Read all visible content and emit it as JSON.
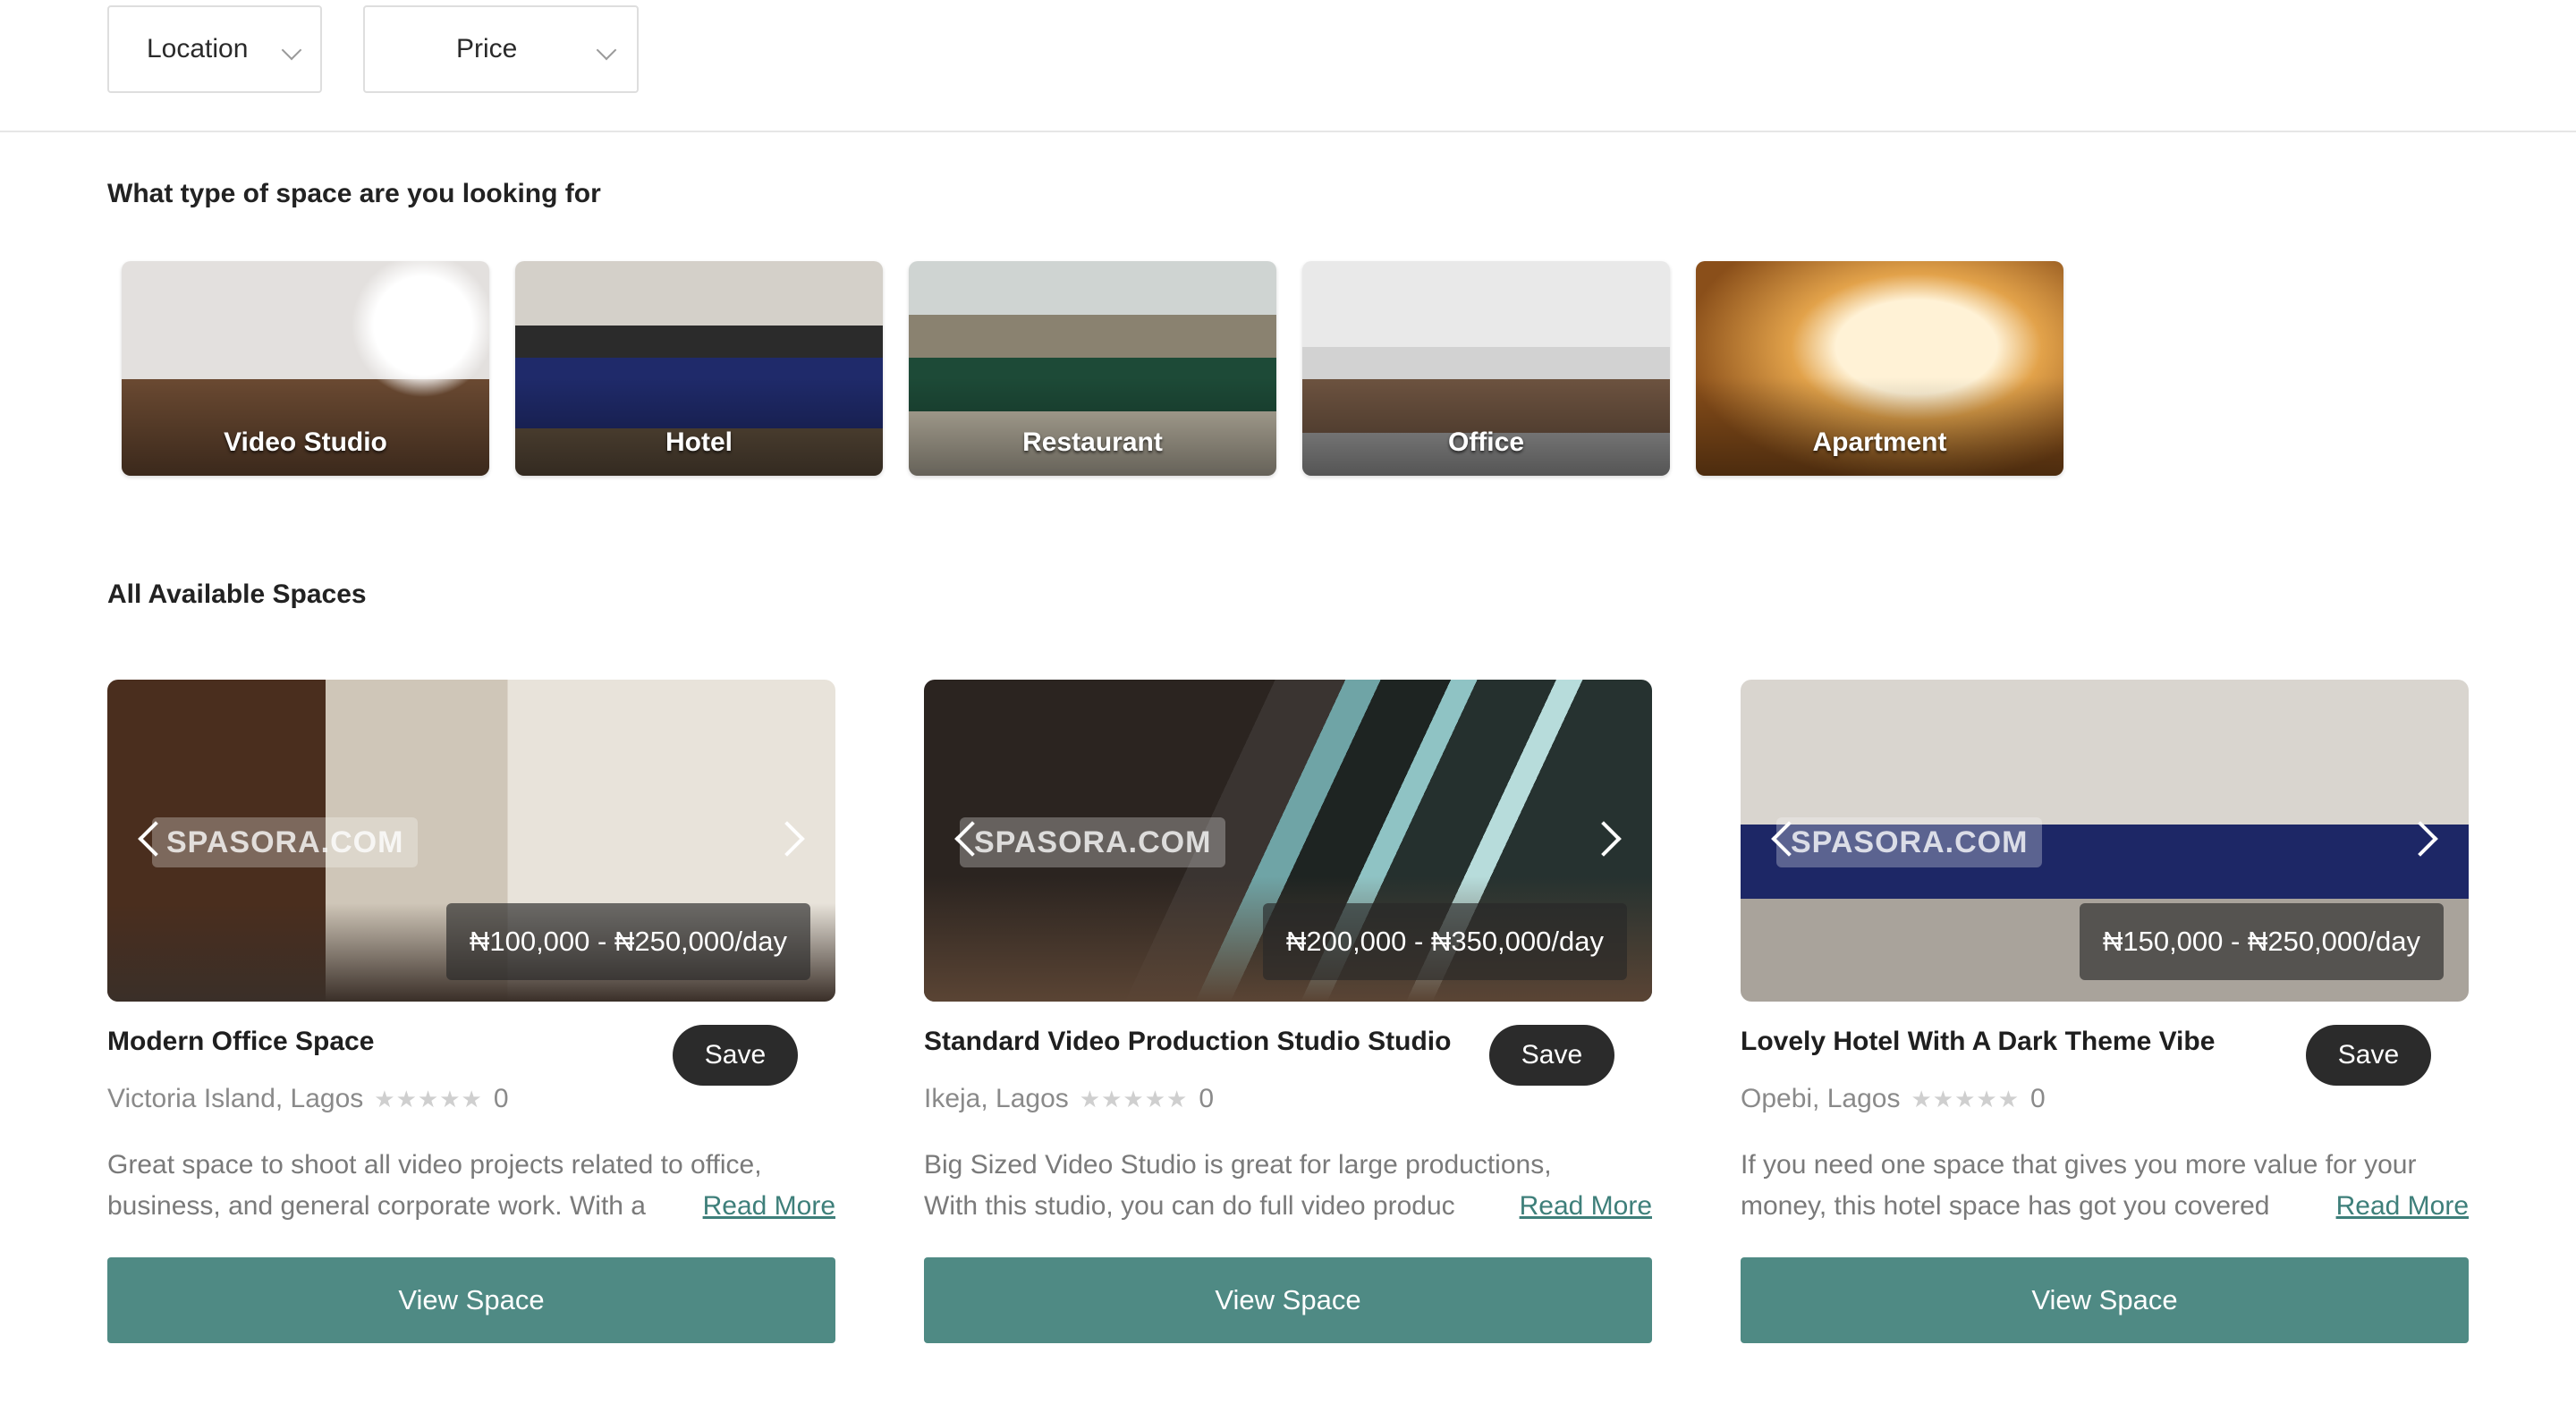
{
  "filters": [
    {
      "label": "Location"
    },
    {
      "label": "Price"
    }
  ],
  "types_title": "What type of space are you looking for",
  "types": [
    {
      "label": "Video Studio"
    },
    {
      "label": "Hotel"
    },
    {
      "label": "Restaurant"
    },
    {
      "label": "Office"
    },
    {
      "label": "Apartment"
    }
  ],
  "spaces_title": "All Available Spaces",
  "spaces": [
    {
      "title": "Modern Office Space",
      "location": "Victoria Island, Lagos",
      "rating_count": "0",
      "stars": "★★★★★",
      "price": "₦100,000 - ₦250,000/day",
      "watermark": "SPASORA.COM",
      "desc_line1": "Great space to shoot all video projects related to office,",
      "desc_line2": "business, and general corporate work. With a",
      "read_more": "Read More",
      "save": "Save",
      "view": "View Space"
    },
    {
      "title": "Standard Video Production Studio Studio",
      "location": "Ikeja, Lagos",
      "rating_count": "0",
      "stars": "★★★★★",
      "price": "₦200,000 - ₦350,000/day",
      "watermark": "SPASORA.COM",
      "desc_line1": "Big Sized Video Studio is great for large productions,",
      "desc_line2": "With this studio, you can do full video produc",
      "read_more": "Read More",
      "save": "Save",
      "view": "View Space"
    },
    {
      "title": "Lovely Hotel With A Dark Theme Vibe",
      "location": "Opebi, Lagos",
      "rating_count": "0",
      "stars": "★★★★★",
      "price": "₦150,000 - ₦250,000/day",
      "watermark": "SPASORA.COM",
      "desc_line1": "If you need one space that gives you more value for your",
      "desc_line2": "money, this hotel space has got you covered",
      "read_more": "Read More",
      "save": "Save",
      "view": "View Space"
    }
  ]
}
